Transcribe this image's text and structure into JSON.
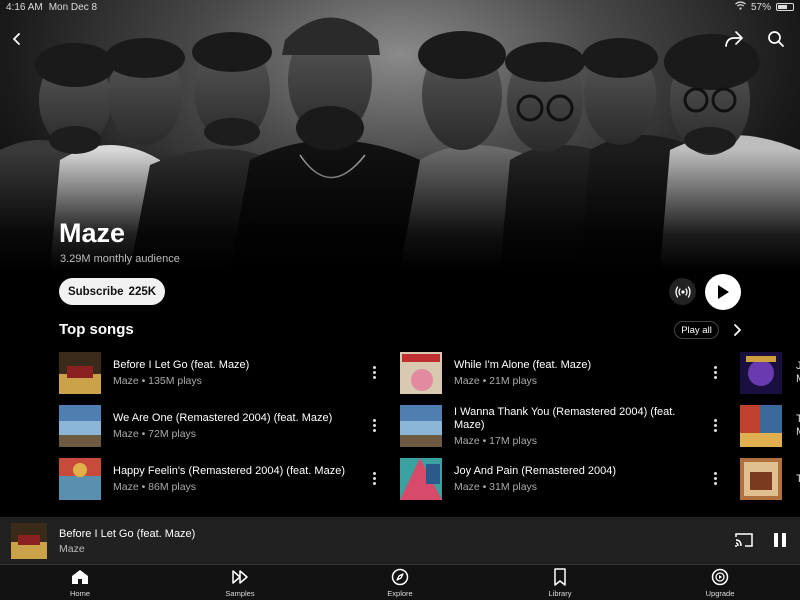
{
  "status": {
    "time": "4:16 AM",
    "date": "Mon Dec 8",
    "battery": "57%"
  },
  "artist": {
    "name": "Maze",
    "audience": "3.29M monthly audience",
    "subscribe_label": "Subscribe",
    "subscriber_count": "225K"
  },
  "top_songs": {
    "title": "Top songs",
    "play_all_label": "Play all",
    "columns": [
      [
        {
          "title": "Before I Let Go (feat. Maze)",
          "sub": "Maze • 135M plays",
          "art": [
            "#3a2a1a",
            "#c9a24a",
            "#8b2020"
          ]
        },
        {
          "title": "We Are One (Remastered 2004) (feat. Maze)",
          "sub": "Maze • 72M plays",
          "art": [
            "#4f7fb0",
            "#8bb6d8",
            "#6e5a40"
          ]
        },
        {
          "title": "Happy Feelin's (Remastered 2004) (feat. Maze)",
          "sub": "Maze • 86M plays",
          "art": [
            "#c74a3a",
            "#5a8fb0",
            "#e2b04a"
          ]
        }
      ],
      [
        {
          "title": "While I'm Alone (feat. Maze)",
          "sub": "Maze • 21M plays",
          "art": [
            "#d8c9b0",
            "#c03030",
            "#e48aa0"
          ]
        },
        {
          "title": "I Wanna Thank You (Remastered 2004) (feat. Maze)",
          "sub": "Maze • 17M plays",
          "art": [
            "#4f7fb0",
            "#8bb6d8",
            "#6e5a40"
          ]
        },
        {
          "title": "Joy And Pain (Remastered 2004)",
          "sub": "Maze • 31M plays",
          "art": [
            "#3aa0a0",
            "#d84a6a",
            "#2a5a8a"
          ]
        }
      ]
    ],
    "peek": [
      {
        "text1": "J",
        "text2": "M",
        "art": [
          "#1a1040",
          "#6a3ab0",
          "#d0a040"
        ]
      },
      {
        "text1": "T",
        "text2": "M",
        "art": [
          "#c04030",
          "#3a6a9a",
          "#e0b050"
        ]
      },
      {
        "text1": "T",
        "text2": "",
        "art": [
          "#b07040",
          "#e0c090",
          "#7a3a20"
        ]
      }
    ]
  },
  "now_playing": {
    "title": "Before I Let Go (feat. Maze)",
    "artist": "Maze"
  },
  "nav": [
    {
      "label": "Home",
      "icon": "home-icon"
    },
    {
      "label": "Samples",
      "icon": "samples-icon"
    },
    {
      "label": "Explore",
      "icon": "explore-icon"
    },
    {
      "label": "Library",
      "icon": "library-icon"
    },
    {
      "label": "Upgrade",
      "icon": "upgrade-icon"
    }
  ]
}
